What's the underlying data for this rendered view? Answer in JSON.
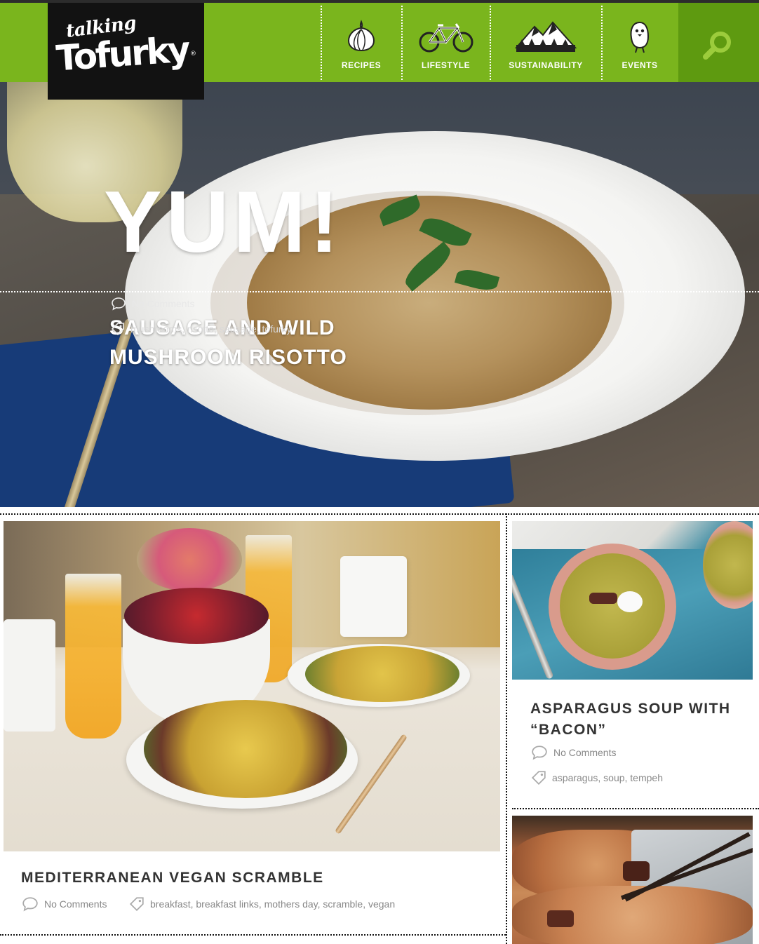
{
  "brand": {
    "top_word": "talking",
    "main_word": "Tofurky",
    "mark": "®"
  },
  "nav": [
    {
      "label": "RECIPES",
      "icon": "onion-icon"
    },
    {
      "label": "LIFESTYLE",
      "icon": "bicycle-icon"
    },
    {
      "label": "SUSTAINABILITY",
      "icon": "mountain-icon"
    },
    {
      "label": "EVENTS",
      "icon": "bird-icon"
    }
  ],
  "search": {
    "icon": "search-icon"
  },
  "hero": {
    "tagline": "YUM!",
    "title": "SAUSAGE AND WILD MUSHROOM RISOTTO",
    "comments": "No Comments",
    "tags": "mushrooms, risotto, sausage, tofurky"
  },
  "posts": [
    {
      "title": "MEDITERRANEAN VEGAN SCRAMBLE",
      "comments": "No Comments",
      "tags": "breakfast, breakfast links, mothers day, scramble, vegan"
    },
    {
      "title": "ASPARAGUS SOUP WITH “BACON”",
      "comments": "No Comments",
      "tags": "asparagus, soup, tempeh"
    }
  ],
  "colors": {
    "brand_green": "#7ab51d",
    "search_green": "#5e9a10",
    "logo_black": "#121212",
    "title_text": "#333333",
    "meta_text": "#888888"
  }
}
